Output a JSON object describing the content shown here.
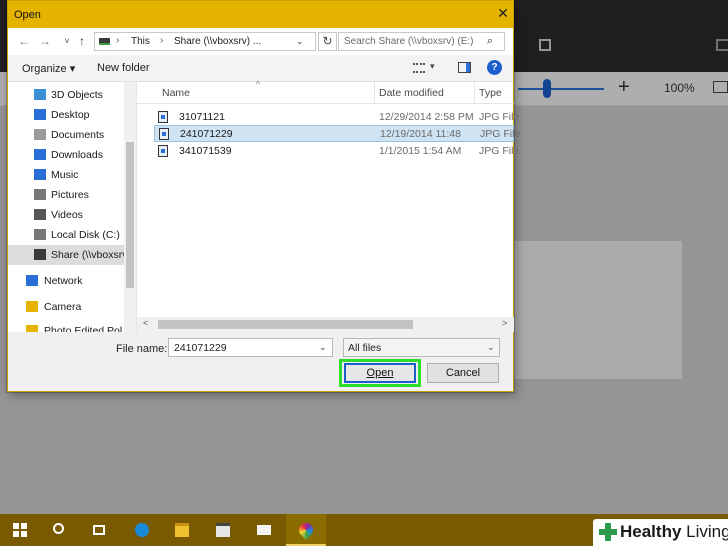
{
  "background_app": {
    "zoom_label": "100%",
    "zoom_plus_label": "+",
    "icons": [
      "crop-icon",
      "image-icon"
    ]
  },
  "dialog": {
    "title": "Open",
    "close_label": "✕",
    "nav": {
      "back": "←",
      "forward": "→",
      "recent_dropdown": "˅",
      "up": "↑",
      "address_parts": [
        "This",
        "Share (\\\\vboxsrv) ..."
      ],
      "address_separator": "›",
      "address_dropdown": "⌄",
      "refresh": "↻",
      "search_placeholder": "Search Share (\\\\vboxsrv) (E:)",
      "search_icon": "⌕"
    },
    "command_bar": {
      "organize": "Organize ▾",
      "new_folder": "New folder",
      "view_dropdown": "▾",
      "help": "?"
    },
    "nav_pane": [
      {
        "label": "3D Objects",
        "icon": "cube-icon",
        "color": "#3a8fd6"
      },
      {
        "label": "Desktop",
        "icon": "desktop-icon",
        "color": "#2a6fd6"
      },
      {
        "label": "Documents",
        "icon": "documents-icon",
        "color": "#9a9a9a"
      },
      {
        "label": "Downloads",
        "icon": "download-icon",
        "color": "#2a6fd6"
      },
      {
        "label": "Music",
        "icon": "music-icon",
        "color": "#2a6fd6"
      },
      {
        "label": "Pictures",
        "icon": "pictures-icon",
        "color": "#777777"
      },
      {
        "label": "Videos",
        "icon": "videos-icon",
        "color": "#555555"
      },
      {
        "label": "Local Disk (C:)",
        "icon": "local-disk-icon",
        "color": "#777777"
      },
      {
        "label": "Share (\\\\vboxsrv",
        "icon": "network-drive-icon",
        "color": "#3a3a3a",
        "selected": true
      },
      {
        "label": "Network",
        "icon": "network-icon",
        "color": "#2a6fd6",
        "top": true
      },
      {
        "label": "Camera",
        "icon": "folder-icon",
        "color": "#e4b400",
        "top": true
      },
      {
        "label": "Photo Edited Pol",
        "icon": "folder-icon",
        "color": "#e4b400",
        "top": true
      }
    ],
    "columns": {
      "name": "Name",
      "date": "Date modified",
      "type": "Type",
      "sort_arrow": "^"
    },
    "files": [
      {
        "name": "31071121",
        "date": "12/29/2014 2:58 PM",
        "type": "JPG File"
      },
      {
        "name": "241071229",
        "date": "12/19/2014 11:48",
        "type": "JPG File",
        "selected": true
      },
      {
        "name": "341071539",
        "date": "1/1/2015 1:54 AM",
        "type": "JPG File"
      }
    ],
    "hscroll": {
      "left": "<",
      "right": ">"
    },
    "file_name_label": "File name:",
    "file_name_value": "241071229",
    "file_type_value": "All files",
    "dropdown_glyph": "⌄",
    "open_button": "Open",
    "cancel_button": "Cancel"
  },
  "taskbar": {
    "items": [
      "start",
      "search",
      "task-view",
      "edge",
      "file-explorer",
      "store",
      "mail",
      "photos"
    ],
    "active": "photos"
  },
  "watermark": {
    "brand": "Healthy",
    "suffix": " Living",
    "accent": "#2e9b4a"
  }
}
